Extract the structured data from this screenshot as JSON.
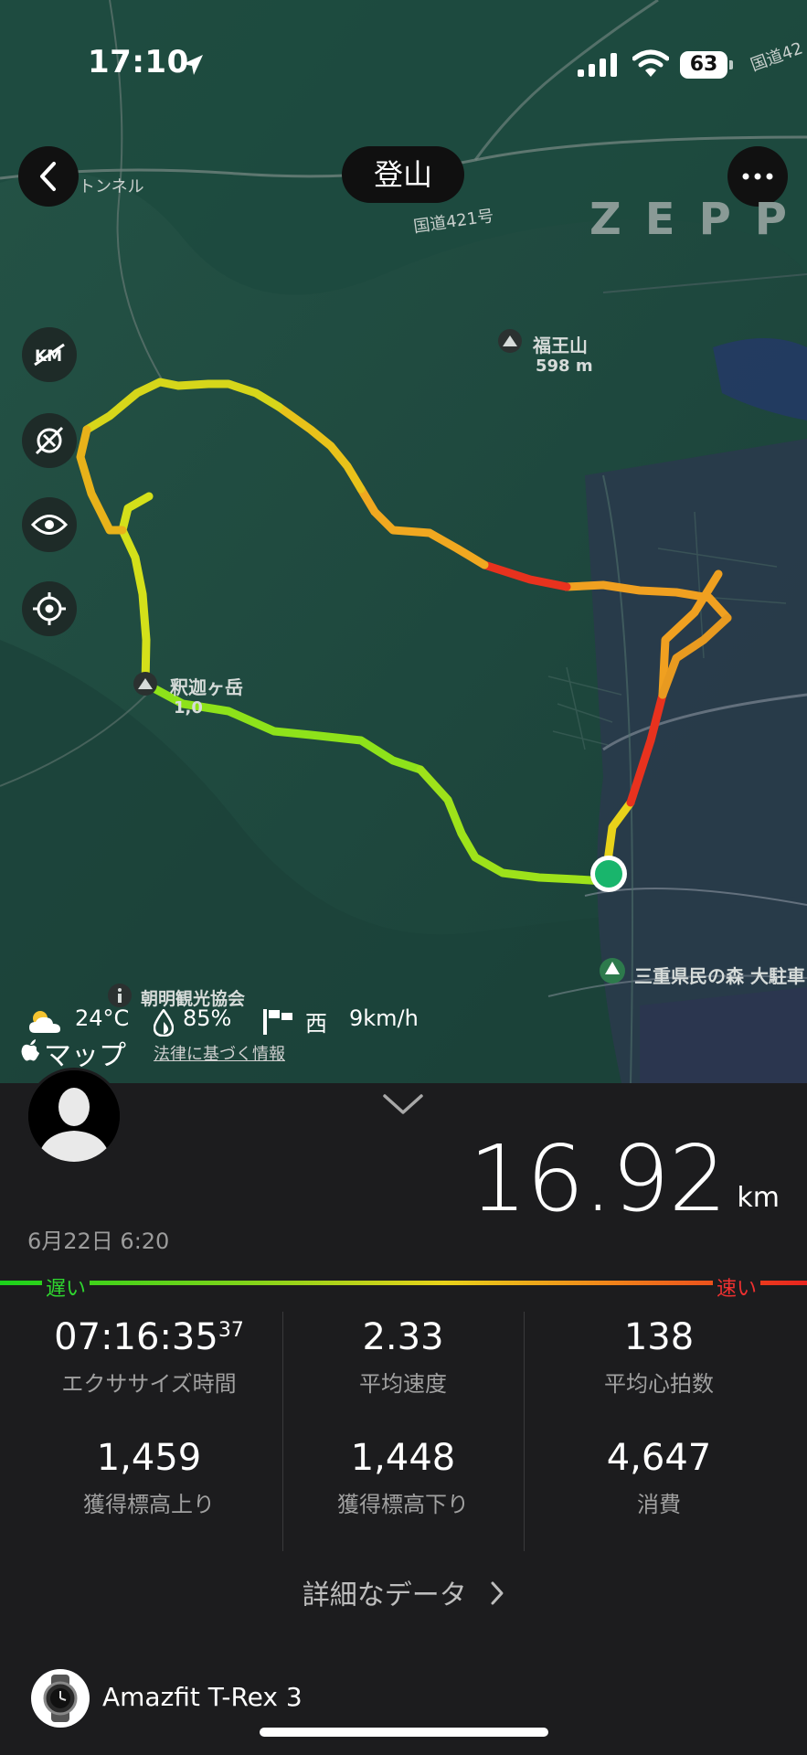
{
  "status_bar": {
    "time": "17:10",
    "battery": "63"
  },
  "header": {
    "title": "登山",
    "brand": "ZEPP"
  },
  "map_labels": {
    "tunnel": "トンネル",
    "route421_top": "国道421号",
    "route421_corner": "国道42",
    "peak_fukuou": "福王山",
    "peak_fukuou_elev": "598 m",
    "peak_shaka": "釈迦ヶ岳",
    "peak_shaka_elev": "1,0",
    "forest": "三重県民の森 大駐車",
    "tourism": "朝明観光協会"
  },
  "weather": {
    "temp": "24°C",
    "humidity": "85%",
    "wind_dir": "西",
    "wind_speed": "9km/h"
  },
  "map_attribution": {
    "apple_maps": "マップ",
    "legal": "法律に基づく情報"
  },
  "activity": {
    "distance": "16.92",
    "distance_unit": "km",
    "date": "6月22日 6:20",
    "speed_slow_label": "遅い",
    "speed_fast_label": "速い"
  },
  "stats": [
    {
      "value": "07:16:35",
      "sup": "37",
      "label": "エクササイズ時間"
    },
    {
      "value": "2.33",
      "label": "平均速度"
    },
    {
      "value": "138",
      "label": "平均心拍数"
    },
    {
      "value": "1,459",
      "label": "獲得標高上り"
    },
    {
      "value": "1,448",
      "label": "獲得標高下り"
    },
    {
      "value": "4,647",
      "label": "消費"
    }
  ],
  "details_link": "詳細なデータ",
  "device": {
    "name": "Amazfit T-Rex 3"
  },
  "colors": {
    "slow": "#1bd21b",
    "fast": "#e8231e",
    "map_bg": "#1f4a40"
  }
}
